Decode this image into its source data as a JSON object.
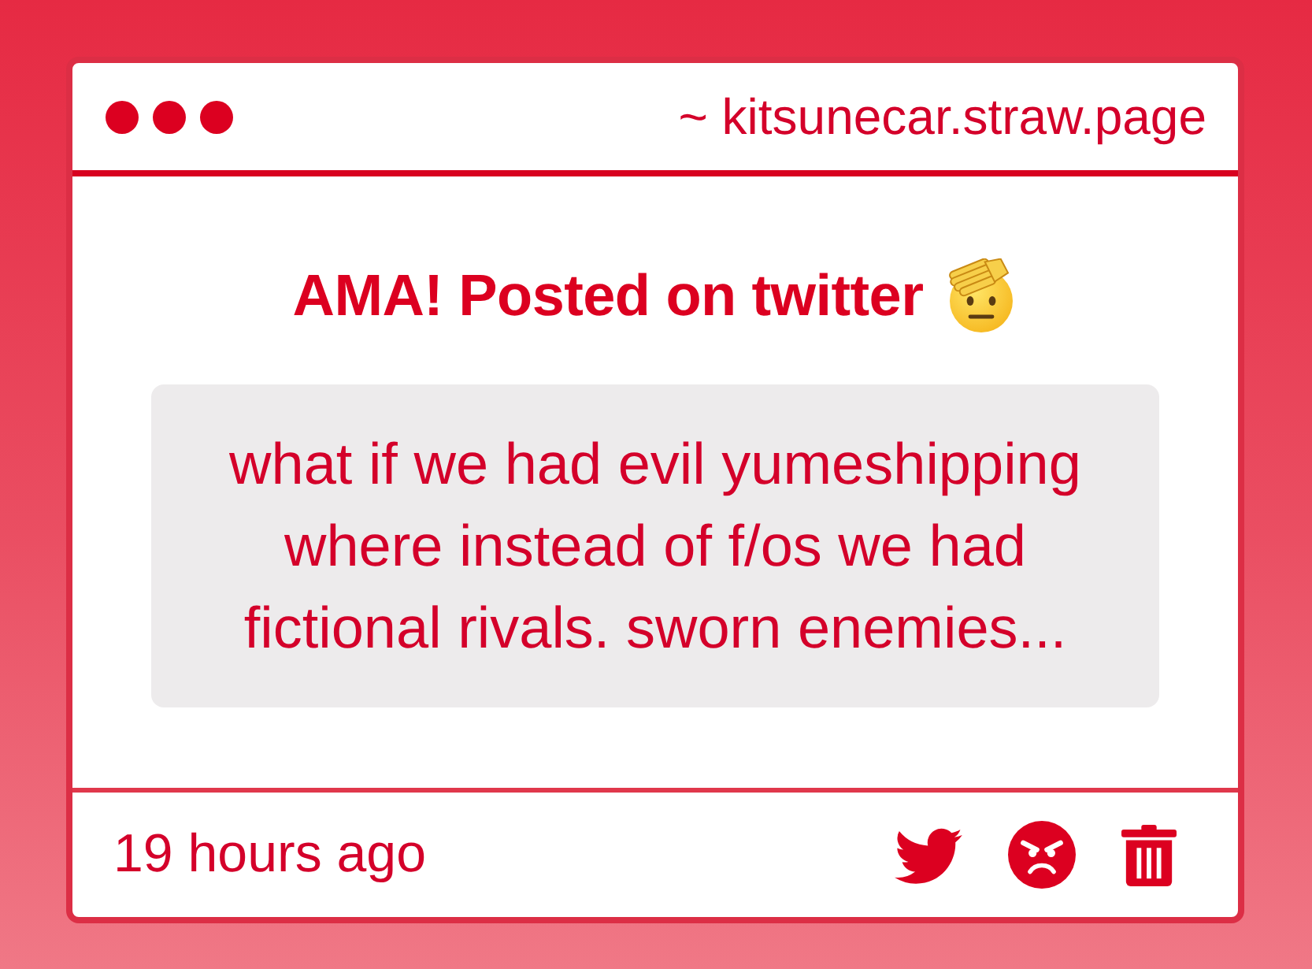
{
  "window": {
    "title": "~ kitsunecar.straw.page"
  },
  "post": {
    "title": "AMA! Posted on twitter",
    "question": "what if we had evil yumeshipping where instead of f/os we had fictional rivals. sworn enemies..."
  },
  "footer": {
    "time": "19 hours ago"
  }
}
